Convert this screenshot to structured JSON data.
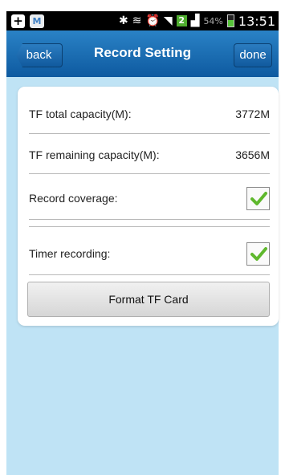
{
  "status_bar": {
    "battery_percent": "54%",
    "signal_badge": "2",
    "time": "13:51"
  },
  "nav": {
    "back_label": "back",
    "title": "Record Setting",
    "done_label": "done"
  },
  "settings": {
    "tf_total": {
      "label": "TF total capacity(M):",
      "value": "3772M"
    },
    "tf_remaining": {
      "label": "TF remaining capacity(M):",
      "value": "3656M"
    },
    "record_coverage": {
      "label": "Record coverage:",
      "checked": true
    },
    "timer_recording": {
      "label": "Timer recording:",
      "checked": true
    }
  },
  "format_button": {
    "label": "Format TF Card"
  },
  "colors": {
    "nav_bar": "#1565ad",
    "background": "#bfe3f5",
    "check": "#5fb82d"
  }
}
